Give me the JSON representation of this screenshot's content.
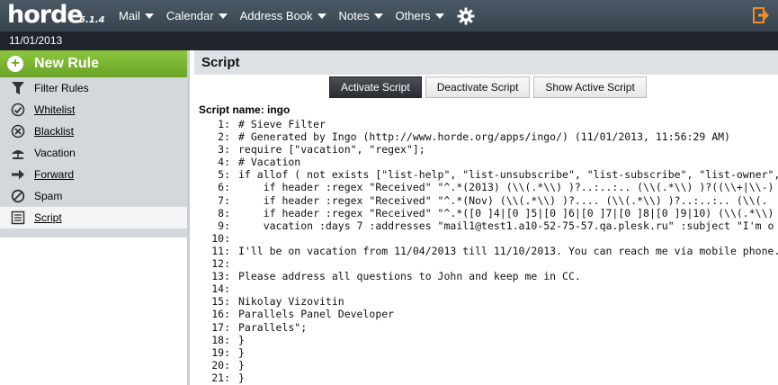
{
  "header": {
    "logo": "horde",
    "version": "5.1.4",
    "nav": [
      {
        "label": "Mail"
      },
      {
        "label": "Calendar"
      },
      {
        "label": "Address Book"
      },
      {
        "label": "Notes"
      },
      {
        "label": "Others"
      }
    ]
  },
  "datebar": {
    "date": "11/01/2013"
  },
  "sidebar": {
    "new_rule": "New Rule",
    "items": [
      {
        "label": "Filter Rules",
        "icon": "filter-icon"
      },
      {
        "label": "Whitelist",
        "icon": "checkmark-circle-icon"
      },
      {
        "label": "Blacklist",
        "icon": "x-circle-icon"
      },
      {
        "label": "Vacation",
        "icon": "vacation-icon"
      },
      {
        "label": "Forward",
        "icon": "arrow-right-icon"
      },
      {
        "label": "Spam",
        "icon": "no-symbol-icon"
      },
      {
        "label": "Script",
        "icon": "script-icon"
      }
    ]
  },
  "main": {
    "title": "Script",
    "buttons": {
      "activate": "Activate Script",
      "deactivate": "Deactivate Script",
      "show": "Show Active Script"
    },
    "script_name": "Script name: ingo",
    "lines": [
      {
        "n": "1:",
        "t": "# Sieve Filter"
      },
      {
        "n": "2:",
        "t": "# Generated by Ingo (http://www.horde.org/apps/ingo/) (11/01/2013, 11:56:29 AM)"
      },
      {
        "n": "3:",
        "t": "require [\"vacation\", \"regex\"];"
      },
      {
        "n": "4:",
        "t": "# Vacation"
      },
      {
        "n": "5:",
        "t": "if allof ( not exists [\"list-help\", \"list-unsubscribe\", \"list-subscribe\", \"list-owner\", \"l"
      },
      {
        "n": "6:",
        "t": "    if header :regex \"Received\" \"^.*(2013) (\\\\(.*\\\\) )?..:..:.. (\\\\(.*\\\\) )?((\\\\+|\\\\-)"
      },
      {
        "n": "7:",
        "t": "    if header :regex \"Received\" \"^.*(Nov) (\\\\(.*\\\\) )?.... (\\\\(.*\\\\) )?..:..:.. (\\\\(."
      },
      {
        "n": "8:",
        "t": "    if header :regex \"Received\" \"^.*([0 ]4|[0 ]5|[0 ]6|[0 ]7|[0 ]8|[0 ]9|10) (\\\\(.*\\\\)"
      },
      {
        "n": "9:",
        "t": "    vacation :days 7 :addresses \"mail1@test1.a10-52-75-57.qa.plesk.ru\" :subject \"I'm o"
      },
      {
        "n": "10:",
        "t": ""
      },
      {
        "n": "11:",
        "t": "I'll be on vacation from 11/04/2013 till 11/10/2013. You can reach me via mobile phone."
      },
      {
        "n": "12:",
        "t": ""
      },
      {
        "n": "13:",
        "t": "Please address all questions to John and keep me in CC."
      },
      {
        "n": "14:",
        "t": ""
      },
      {
        "n": "15:",
        "t": "Nikolay Vizovitin"
      },
      {
        "n": "16:",
        "t": "Parallels Panel Developer"
      },
      {
        "n": "17:",
        "t": "Parallels\";"
      },
      {
        "n": "18:",
        "t": "}"
      },
      {
        "n": "19:",
        "t": "}"
      },
      {
        "n": "20:",
        "t": "}"
      },
      {
        "n": "21:",
        "t": "}"
      }
    ]
  }
}
